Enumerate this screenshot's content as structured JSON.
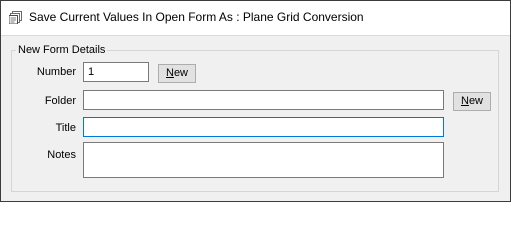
{
  "header": {
    "title": "Save Current Values In Open Form As : Plane Grid Conversion",
    "icon": "form-stack-icon"
  },
  "group": {
    "legend": "New Form Details"
  },
  "fields": {
    "number": {
      "label": "Number",
      "value": "1"
    },
    "folder": {
      "label": "Folder",
      "value": ""
    },
    "title": {
      "label": "Title",
      "value": ""
    },
    "notes": {
      "label": "Notes",
      "value": ""
    }
  },
  "buttons": {
    "number_new": {
      "mnemonic": "N",
      "rest": "ew"
    },
    "folder_new": {
      "mnemonic": "N",
      "rest": "ew"
    }
  },
  "colors": {
    "focus_border": "#0078d7",
    "panel_background": "#f0f0f0"
  }
}
